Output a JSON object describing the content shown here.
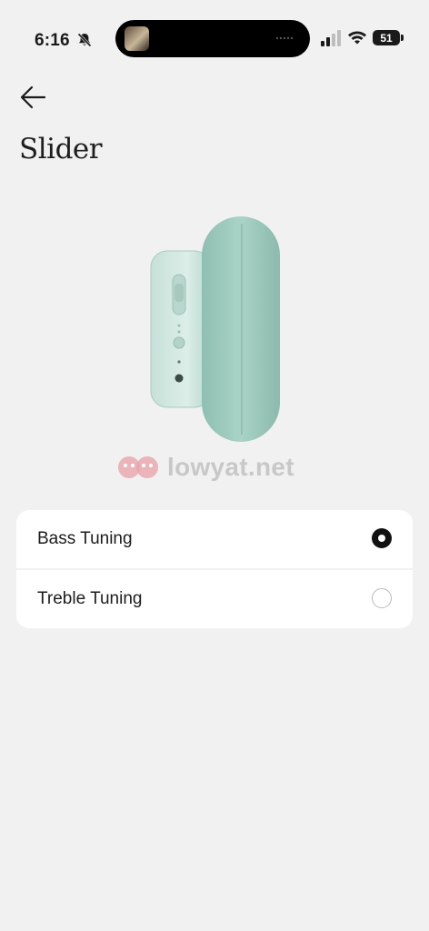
{
  "status_bar": {
    "time": "6:16",
    "battery": "51",
    "icons": [
      "bell-slash-icon",
      "signal-icon",
      "wifi-icon",
      "battery-icon"
    ]
  },
  "header": {
    "back_icon": "arrow-left-icon",
    "title": "Slider"
  },
  "watermark": {
    "text": "lowyat.net"
  },
  "options": [
    {
      "label": "Bass Tuning",
      "selected": true
    },
    {
      "label": "Treble Tuning",
      "selected": false
    }
  ],
  "colors": {
    "background": "#f1f1f1",
    "card": "#ffffff",
    "headphone_mint": "#a9d2c6",
    "radio_selected": "#111111"
  }
}
